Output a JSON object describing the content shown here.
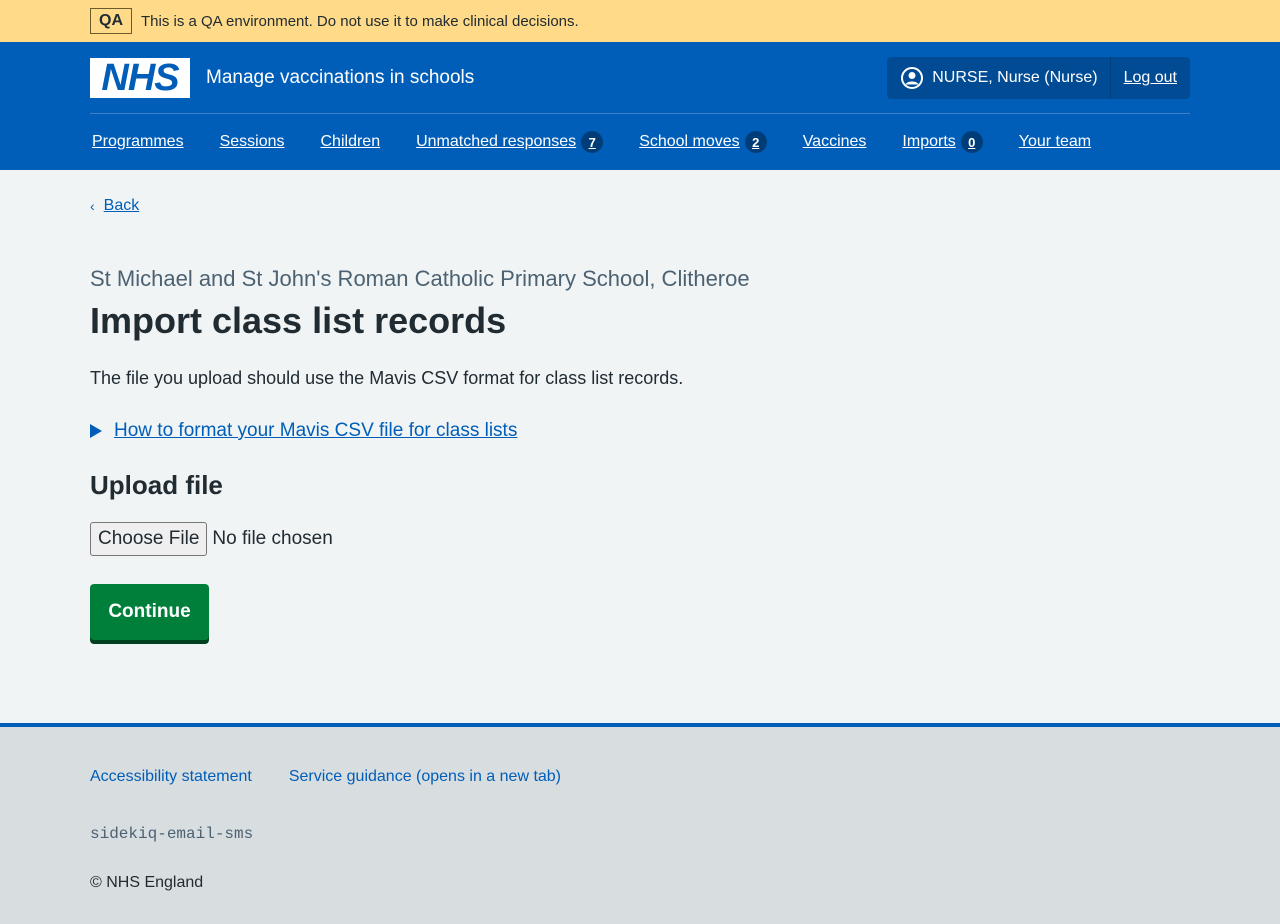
{
  "banner": {
    "tag": "QA",
    "text": "This is a QA environment. Do not use it to make clinical decisions."
  },
  "header": {
    "logo_text": "NHS",
    "service_name": "Manage vaccinations in schools",
    "user_label": "NURSE, Nurse (Nurse)",
    "logout_label": "Log out"
  },
  "nav": {
    "items": [
      {
        "label": "Programmes"
      },
      {
        "label": "Sessions"
      },
      {
        "label": "Children"
      },
      {
        "label": "Unmatched responses",
        "badge": "7"
      },
      {
        "label": "School moves",
        "badge": "2"
      },
      {
        "label": "Vaccines"
      },
      {
        "label": "Imports",
        "badge": "0"
      },
      {
        "label": "Your team"
      }
    ]
  },
  "main": {
    "back_label": "Back",
    "caption": "St Michael and St John's Roman Catholic Primary School, Clitheroe",
    "title": "Import class list records",
    "intro": "The file you upload should use the Mavis CSV format for class list records.",
    "details_summary": "How to format your Mavis CSV file for class lists",
    "upload_label": "Upload file",
    "file_button_label": "Choose File",
    "file_status": "No file chosen",
    "continue_label": "Continue"
  },
  "footer": {
    "links": [
      "Accessibility statement",
      "Service guidance (opens in a new tab)"
    ],
    "code": "sidekiq-email-sms",
    "copyright": "© NHS England"
  },
  "colors": {
    "nhs_blue": "#005eb8",
    "banner_yellow": "#ffdb89",
    "button_green": "#007f3b",
    "page_bg": "#f0f4f5",
    "footer_bg": "#d8dde0"
  }
}
